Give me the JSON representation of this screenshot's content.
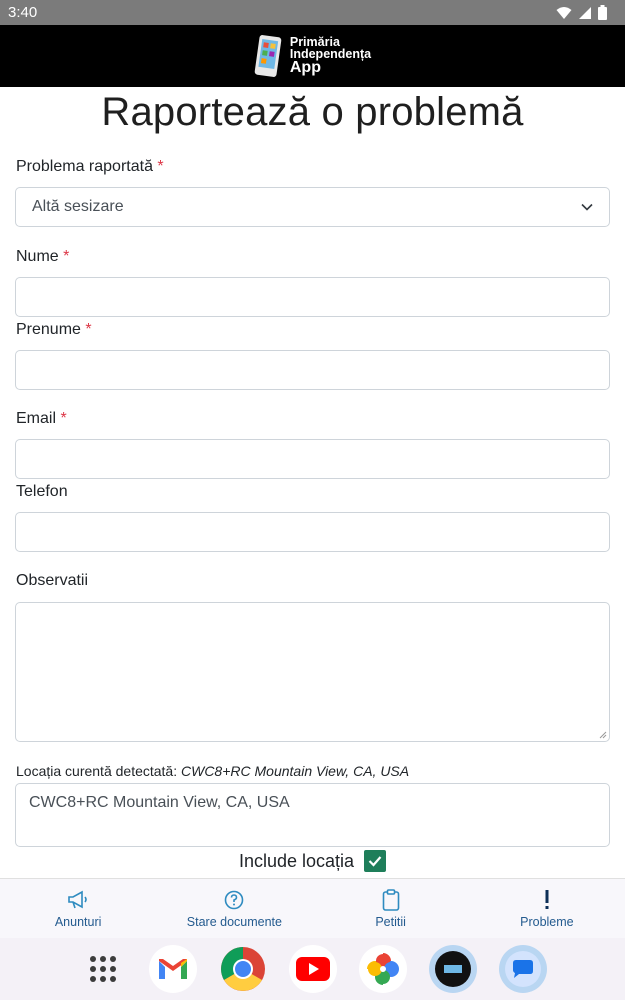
{
  "status_bar": {
    "time": "3:40"
  },
  "header": {
    "logo_line1": "Primăria",
    "logo_line2": "Independența",
    "logo_line3": "App"
  },
  "page": {
    "title": "Raportează o problemă"
  },
  "form": {
    "problem_label": "Problema raportată",
    "problem_value": "Altă sesizare",
    "nume_label": "Nume",
    "prenume_label": "Prenume",
    "email_label": "Email",
    "telefon_label": "Telefon",
    "observatii_label": "Observatii",
    "required_marker": "*",
    "location_label": "Locația curentă detectată:",
    "location_detected": "CWC8+RC Mountain View, CA, USA",
    "location_value": "CWC8+RC Mountain View, CA, USA",
    "include_location_label": "Include locația",
    "include_location_checked": true
  },
  "bottom_nav": {
    "items": [
      {
        "label": "Anunturi",
        "icon": "megaphone-icon"
      },
      {
        "label": "Stare documente",
        "icon": "question-circle-icon"
      },
      {
        "label": "Petitii",
        "icon": "clipboard-icon"
      },
      {
        "label": "Probleme",
        "icon": "exclamation-icon"
      }
    ]
  },
  "dock": {
    "apps": [
      "app-drawer",
      "gmail",
      "chrome",
      "youtube",
      "photos",
      "primaria-app",
      "messages"
    ]
  },
  "colors": {
    "accent": "#245b8f",
    "required": "#dc3545",
    "checkbox": "#1e7e5a",
    "header_bg": "#000000"
  }
}
